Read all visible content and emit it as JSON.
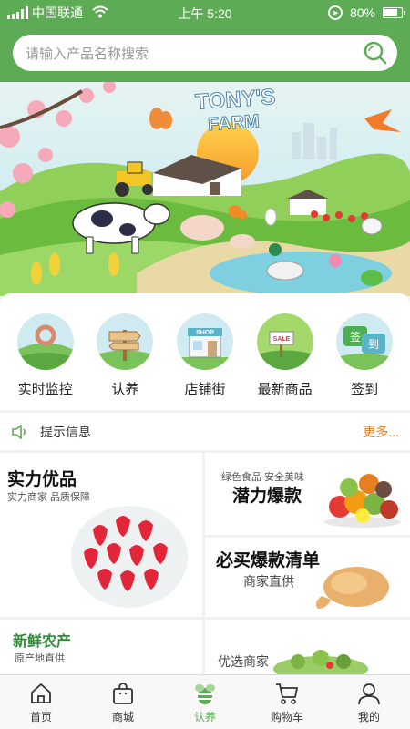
{
  "status_bar": {
    "carrier": "中国联通",
    "time": "上午 5:20",
    "battery": "80%",
    "battery_level": 0.8
  },
  "search": {
    "placeholder": "请输入产品名称搜索"
  },
  "banner": {
    "logo_line1": "TONY'S",
    "logo_line2": "FARM"
  },
  "categories": [
    {
      "label": "实时监控",
      "icon": "donut-hill-icon"
    },
    {
      "label": "认养",
      "icon": "signpost-icon"
    },
    {
      "label": "店铺街",
      "icon": "shop-icon",
      "badge": "SHOP"
    },
    {
      "label": "最新商品",
      "icon": "sale-sign-icon",
      "badge": "SALE"
    },
    {
      "label": "签到",
      "icon": "checkin-icon",
      "badge1": "签",
      "badge2": "到"
    }
  ],
  "notice": {
    "text": "提示信息",
    "more": "更多..."
  },
  "cards": {
    "strength": {
      "title": "实力优品",
      "subtitle": "实力商家  品质保障"
    },
    "potential": {
      "tagline": "绿色食品  安全美味",
      "title": "潜力爆款"
    },
    "must_buy": {
      "title": "必买爆款清单",
      "subtitle": "商家直供"
    },
    "fresh": {
      "title": "新鲜农产",
      "subtitle": "原产地直供"
    },
    "selected": {
      "subtitle": "优选商家"
    }
  },
  "tabbar": [
    {
      "label": "首页",
      "icon": "home-icon",
      "active": false
    },
    {
      "label": "商城",
      "icon": "shopping-bag-icon",
      "active": false
    },
    {
      "label": "认养",
      "icon": "bee-icon",
      "active": true
    },
    {
      "label": "购物车",
      "icon": "cart-icon",
      "active": false
    },
    {
      "label": "我的",
      "icon": "user-icon",
      "active": false
    }
  ],
  "colors": {
    "brand_green": "#5dab55",
    "more_orange": "#e8781c",
    "fresh_green": "#2e8b36"
  }
}
